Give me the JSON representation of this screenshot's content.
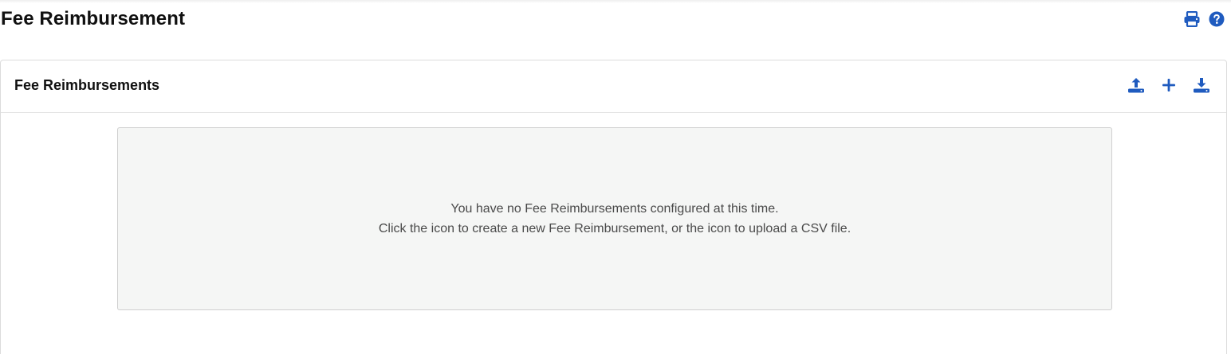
{
  "page": {
    "title": "Fee Reimbursement"
  },
  "header_actions": {
    "print_icon": "print-icon",
    "help_icon": "help-icon"
  },
  "card": {
    "title": "Fee Reimbursements",
    "actions": {
      "upload_icon": "upload-icon",
      "add_icon": "plus-icon",
      "download_icon": "download-icon"
    },
    "empty_state": {
      "line1": "You have no Fee Reimbursements configured at this time.",
      "line2": "Click the icon to create a new Fee Reimbursement, or the icon to upload a CSV file."
    }
  },
  "colors": {
    "accent": "#1f5bbf",
    "empty_bg": "#f5f6f5",
    "border": "#dcdcdc"
  }
}
